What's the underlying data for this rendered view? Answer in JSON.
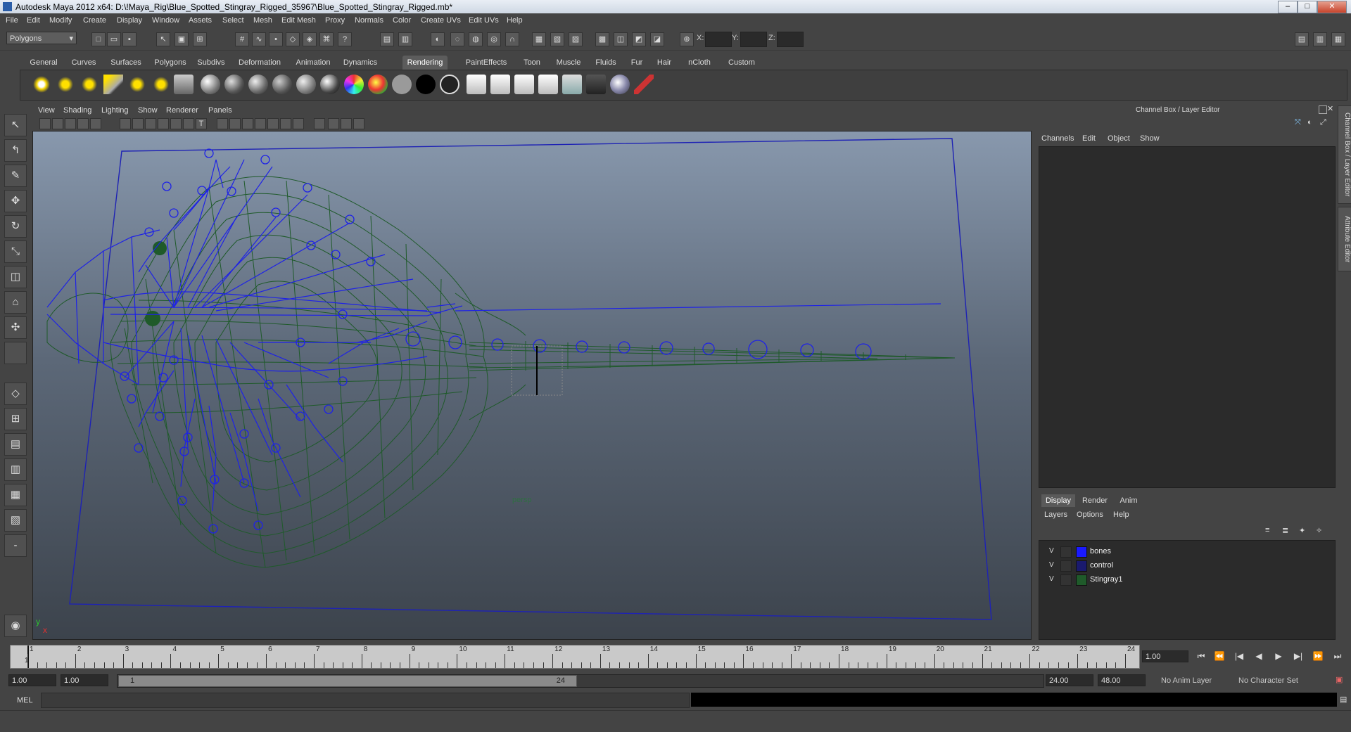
{
  "window": {
    "title": "Autodesk Maya 2012 x64: D:\\!Maya_Rig\\Blue_Spotted_Stingray_Rigged_35967\\Blue_Spotted_Stingray_Rigged.mb*"
  },
  "menubar": [
    "File",
    "Edit",
    "Modify",
    "Create",
    "Display",
    "Window",
    "Assets",
    "Select",
    "Mesh",
    "Edit Mesh",
    "Proxy",
    "Normals",
    "Color",
    "Create UVs",
    "Edit UVs",
    "Help"
  ],
  "statusline": {
    "mode": "Polygons",
    "x_label": "X:",
    "y_label": "Y:",
    "z_label": "Z:"
  },
  "shelf_tabs": [
    "General",
    "Curves",
    "Surfaces",
    "Polygons",
    "Subdivs",
    "Deformation",
    "Animation",
    "Dynamics",
    "Rendering",
    "PaintEffects",
    "Toon",
    "Muscle",
    "Fluids",
    "Fur",
    "Hair",
    "nCloth",
    "Custom"
  ],
  "shelf_active": "Rendering",
  "viewport": {
    "menu": [
      "View",
      "Shading",
      "Lighting",
      "Show",
      "Renderer",
      "Panels"
    ],
    "camera_label": "persp",
    "axis_y": "y",
    "axis_x": "x"
  },
  "channel_box": {
    "title": "Channel Box / Layer Editor",
    "menu": [
      "Channels",
      "Edit",
      "Object",
      "Show"
    ]
  },
  "side_tabs": [
    "Channel Box / Layer Editor",
    "Attribute Editor"
  ],
  "layer_editor": {
    "tabs": [
      "Display",
      "Render",
      "Anim"
    ],
    "active_tab": "Display",
    "menu": [
      "Layers",
      "Options",
      "Help"
    ],
    "layers": [
      {
        "visible": "V",
        "name": "bones",
        "color": "#1a1aff"
      },
      {
        "visible": "V",
        "name": "control",
        "color": "#1a1a6e"
      },
      {
        "visible": "V",
        "name": "Stingray1",
        "color": "#1f5a2a"
      }
    ]
  },
  "time_slider": {
    "ticks": [
      "1",
      "2",
      "3",
      "4",
      "5",
      "6",
      "7",
      "8",
      "9",
      "10",
      "11",
      "12",
      "13",
      "14",
      "15",
      "16",
      "17",
      "18",
      "19",
      "20",
      "21",
      "22",
      "23",
      "24"
    ],
    "current_marker": "1",
    "current_frame": "1.00"
  },
  "range": {
    "start_time": "1.00",
    "playback_start": "1.00",
    "slider_start": "1",
    "slider_end": "24",
    "playback_end": "24.00",
    "end_time": "48.00",
    "anim_layer": "No Anim Layer",
    "character_set": "No Character Set"
  },
  "command_line": {
    "label": "MEL"
  },
  "colors": {
    "wire_blue": "#1e22e6",
    "mesh_green": "#1f5a2a",
    "accent": "#5c5c5c"
  }
}
